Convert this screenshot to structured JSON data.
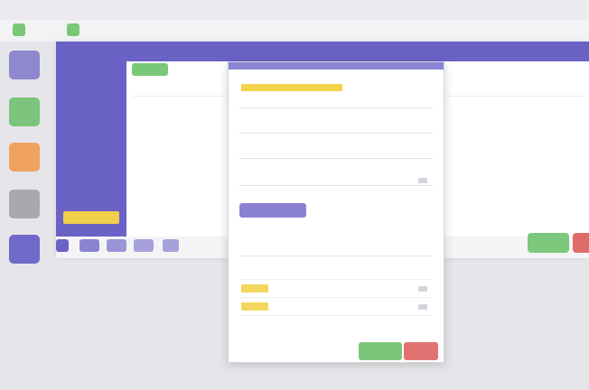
{
  "window": {
    "title": "",
    "toolbar_text": ""
  },
  "dock": {
    "tiles": [
      {
        "icon": "app-icon",
        "color": "#8e88cf"
      },
      {
        "icon": "app-icon",
        "color": "#7cc47c"
      },
      {
        "icon": "app-icon",
        "color": "#f0a35e"
      },
      {
        "icon": "app-icon",
        "color": "#a8a8ae"
      },
      {
        "icon": "app-icon",
        "color": "#7069c9"
      }
    ]
  },
  "app": {
    "header_title": "",
    "nav_items": [
      "",
      "",
      "",
      "",
      "",
      "",
      "",
      "",
      "",
      "",
      ""
    ],
    "active_nav_index": 10,
    "green_tab_label": "",
    "content_heading": "",
    "content_right_heading": "",
    "bottom_buttons": [
      "",
      "",
      "",
      "",
      ""
    ],
    "colors": {
      "primary": "#6b62c6",
      "highlight": "#f0cf4c",
      "success": "#7cc87c",
      "danger": "#e06b6b"
    }
  },
  "modal": {
    "fields": [
      {
        "label": "",
        "value": ""
      },
      {
        "label": "",
        "value": ""
      },
      {
        "label": "",
        "value": ""
      },
      {
        "label": "",
        "value": ""
      },
      {
        "label": "",
        "value": ""
      }
    ],
    "chip_label": "",
    "section_label": "",
    "tags": [
      "",
      ""
    ],
    "footer_text": "",
    "save_label": "",
    "cancel_label": ""
  }
}
